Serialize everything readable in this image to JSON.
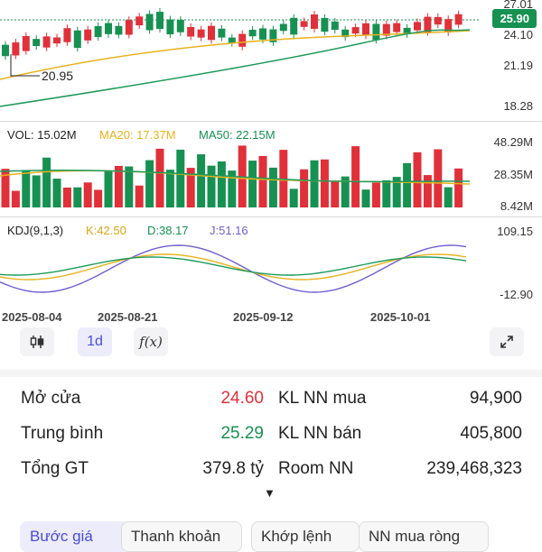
{
  "price": {
    "current_badge": "25.90",
    "axis_labels": [
      "27.01",
      "24.10",
      "21.19",
      "18.28"
    ],
    "low_marker": "20.95"
  },
  "volume": {
    "vol_label": "VOL: 15.02M",
    "ma20_label": "MA20: 17.37M",
    "ma50_label": "MA50: 22.15M",
    "axis_labels": [
      "48.29M",
      "28.35M",
      "8.42M"
    ]
  },
  "kdj": {
    "title": "KDJ(9,1,3)",
    "k_label": "K:42.50",
    "d_label": "D:38.17",
    "j_label": "J:51.16",
    "axis_labels": [
      "109.15",
      "-12.90"
    ]
  },
  "dates": [
    "2025-08-04",
    "2025-08-21",
    "2025-09-12",
    "2025-10-01"
  ],
  "toolbar": {
    "candle_icon": "candlestick-icon",
    "interval": "1d",
    "function_label": "f(x)",
    "expand_icon": "expand-icon"
  },
  "stats": {
    "open_label": "Mở cửa",
    "open_value": "24.60",
    "avg_label": "Trung bình",
    "avg_value": "25.29",
    "total_label": "Tổng GT",
    "total_value": "379.8 tỷ",
    "buy_label": "KL NN mua",
    "buy_value": "94,900",
    "sell_label": "KL NN bán",
    "sell_value": "405,800",
    "room_label": "Room NN",
    "room_value": "239,468,323",
    "more": "▼"
  },
  "tabs": [
    "Bước giá",
    "Thanh khoản",
    "Khớp lệnh",
    "NN mua ròng"
  ],
  "colors": {
    "up": "#179152",
    "down": "#e0303a",
    "ma_yellow": "#e8b21d",
    "ma_green": "#1d9a5b",
    "kdj_j": "#6f5fd0",
    "accent": "#4b4bd8"
  }
}
